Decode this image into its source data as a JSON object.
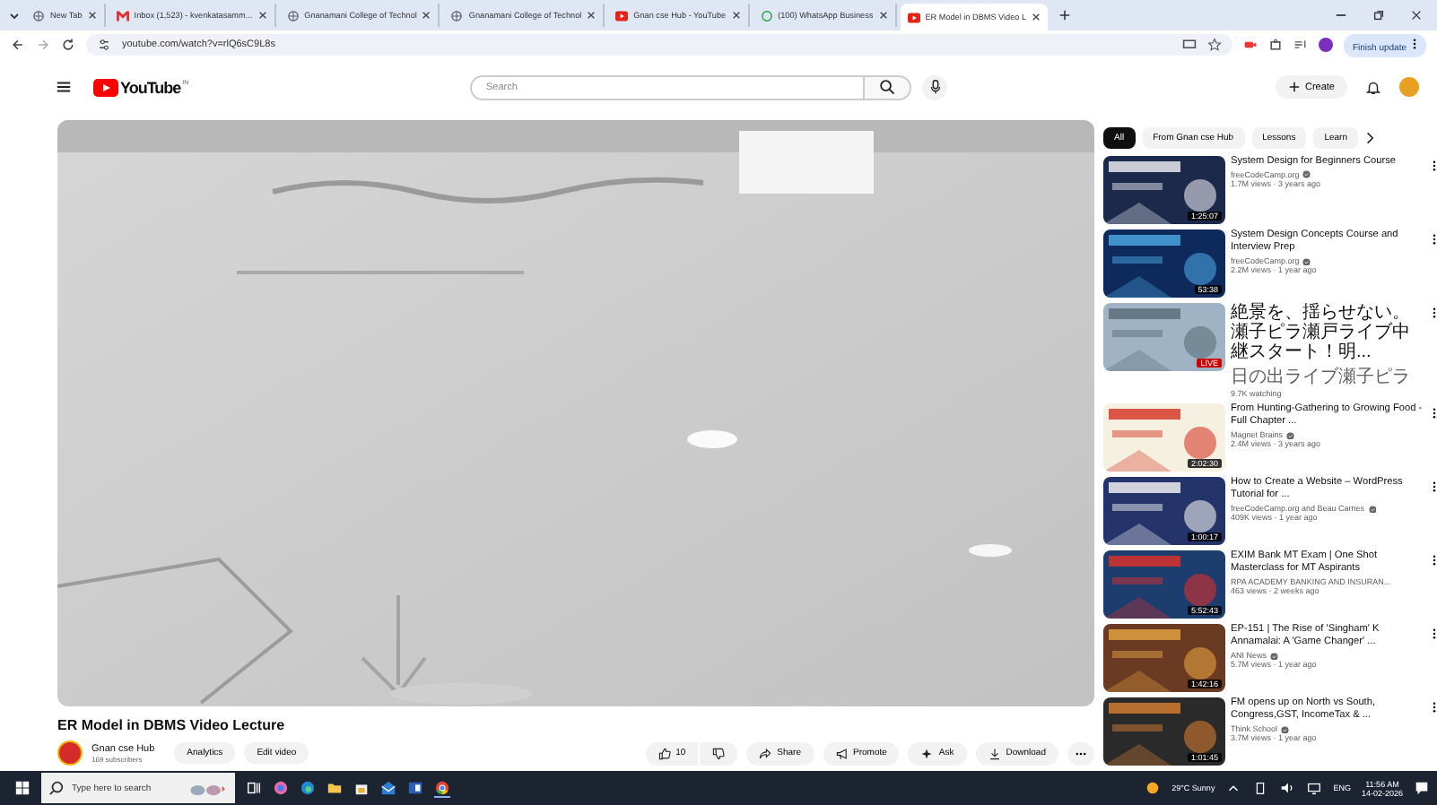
{
  "browser": {
    "tabs": [
      {
        "title": "New Tab",
        "selected": false,
        "kind": "site"
      },
      {
        "title": "Inbox (1,523) - kvenkatasamm...",
        "selected": false,
        "kind": "mail"
      },
      {
        "title": "Gnanamani College of Technol",
        "selected": false,
        "kind": "site"
      },
      {
        "title": "Gnanamani College of Technol",
        "selected": false,
        "kind": "site"
      },
      {
        "title": "Gnan cse Hub - YouTube",
        "selected": false,
        "kind": "video"
      },
      {
        "title": "(100) WhatsApp Business",
        "selected": false,
        "kind": "chat"
      },
      {
        "title": "ER Model in DBMS Video L",
        "selected": true,
        "kind": "video"
      }
    ],
    "address": "youtube.com/watch?v=rlQ6sC9L8s",
    "update_button": "Finish update"
  },
  "header": {
    "logo": "YouTube",
    "region": "IN",
    "search": {
      "placeholder": "Search"
    },
    "create_button": "Create"
  },
  "video": {
    "title": "ER Model in DBMS Video Lecture",
    "channel": "Gnan cse Hub",
    "subscribers": "169 subscribers",
    "buttons": [
      "Analytics",
      "Edit video"
    ],
    "likes": "10",
    "actions": [
      "Share",
      "Promote",
      "Ask",
      "Download"
    ]
  },
  "chips": [
    {
      "label": "All",
      "selected": true
    },
    {
      "label": "From Gnan cse Hub",
      "selected": false
    },
    {
      "label": "Lessons",
      "selected": false
    },
    {
      "label": "Learn",
      "selected": false
    }
  ],
  "recommendations": [
    {
      "title": "System Design for Beginners Course",
      "channel": "freeCodeCamp.org",
      "verified": true,
      "meta": "1.7M views · 3 years ago",
      "badge": {
        "kind": "duration",
        "text": "1:25:07"
      }
    },
    {
      "title": "System Design Concepts Course and Interview Prep",
      "channel": "freeCodeCamp.org",
      "verified": true,
      "meta": "2.2M views · 1 year ago",
      "badge": {
        "kind": "duration",
        "text": "53:38"
      }
    },
    {
      "title": "絶景を、揺らせない。瀬子ピラ瀬戸ライブ中継スタート！明...",
      "channel": "日の出ライブ瀬子ピラ",
      "verified": false,
      "meta": "9.7K watching",
      "badge": {
        "kind": "live",
        "text": "LIVE"
      }
    },
    {
      "title": "From Hunting-Gathering to Growing Food - Full Chapter ...",
      "channel": "Magnet Brains",
      "verified": true,
      "meta": "2.4M views · 3 years ago",
      "badge": {
        "kind": "duration",
        "text": "2:02:30"
      }
    },
    {
      "title": "How to Create a Website – WordPress Tutorial for ...",
      "channel": "freeCodeCamp.org and Beau Carnes",
      "verified": true,
      "meta": "409K views · 1 year ago",
      "badge": {
        "kind": "duration",
        "text": "1:00:17"
      }
    },
    {
      "title": "EXIM Bank MT Exam | One Shot Masterclass for MT Aspirants",
      "channel": "RPA ACADEMY BANKING AND INSURAN...",
      "verified": false,
      "meta": "463 views · 2 weeks ago",
      "badge": {
        "kind": "duration",
        "text": "5:52:43"
      }
    },
    {
      "title": "EP-151 | The Rise of 'Singham' K Annamalai: A 'Game Changer' ...",
      "channel": "ANI News",
      "verified": true,
      "meta": "5.7M views · 1 year ago",
      "badge": {
        "kind": "duration",
        "text": "1:42:16"
      }
    },
    {
      "title": "FM opens up on North vs South, Congress,GST, IncomeTax & ...",
      "channel": "Think School",
      "verified": true,
      "meta": "3.7M views · 1 year ago",
      "badge": {
        "kind": "duration",
        "text": "1:01:45"
      }
    }
  ],
  "taskbar": {
    "search_placeholder": "Type here to search",
    "weather": "29°C  Sunny",
    "language": "ENG",
    "time": "11:56 AM",
    "date": "14-02-2026"
  }
}
